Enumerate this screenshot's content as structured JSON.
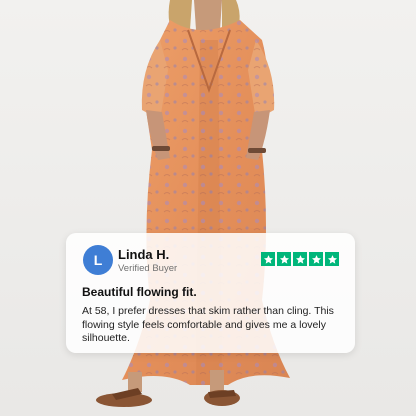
{
  "review": {
    "avatar_initial": "L",
    "name": "Linda H.",
    "badge": "Verified Buyer",
    "rating": 5,
    "max_rating": 5,
    "title": "Beautiful flowing fit.",
    "text": "At 58, I prefer dresses that skim rather than cling. This flowing style feels comfortable and gives me a lovely silhouette."
  },
  "colors": {
    "background": "#efeeec",
    "avatar": "#3f7ed5",
    "star_green": "#00b67a",
    "dress_base": "#e89a62",
    "card": "#ffffff"
  },
  "icons": {
    "star": "star-icon"
  }
}
